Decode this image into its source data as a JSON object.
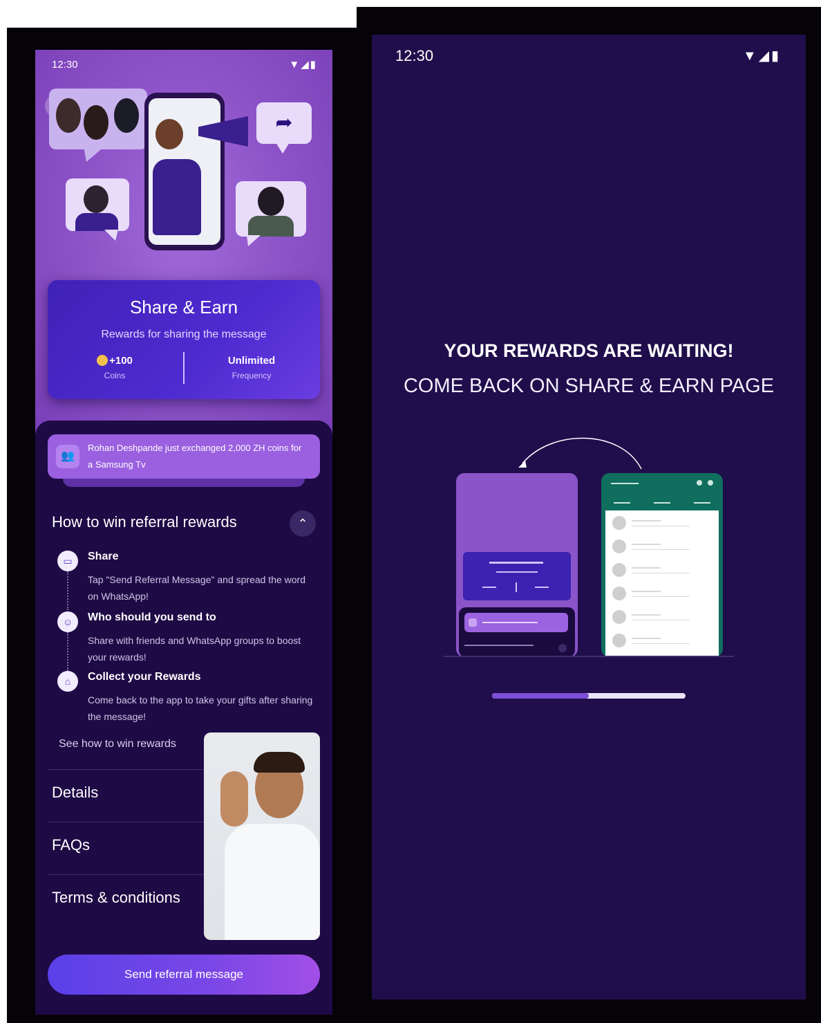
{
  "left_screen": {
    "status_time": "12:30",
    "status_icons": "▼◢▮",
    "card": {
      "title": "Share & Earn",
      "subtitle": "Rewards for sharing the message",
      "coins_value": "+100",
      "coins_label": "Coins",
      "frequency_value": "Unlimited",
      "frequency_label": "Frequency"
    },
    "ticker_text": "Rohan Deshpande just exchanged 2,000 ZH coins for a Samsung Tv",
    "howto_title": "How to win referral rewards",
    "steps": [
      {
        "title": "Share",
        "desc": "Tap \"Send Referral Message\" and spread the word on WhatsApp!"
      },
      {
        "title": "Who should you send to",
        "desc": "Share with friends and WhatsApp groups to boost your rewards!"
      },
      {
        "title": "Collect your Rewards",
        "desc": "Come back to the app to take your gifts after sharing the message!"
      }
    ],
    "see_how": "See how to win rewards",
    "rows": [
      "Details",
      "FAQs",
      "Terms & conditions"
    ],
    "cta": "Send referral message"
  },
  "right_screen": {
    "status_time": "12:30",
    "status_icons": "▼◢▮",
    "headline": "YOUR REWARDS ARE WAITING!",
    "subheadline": "COME BACK ON SHARE & EARN PAGE",
    "progress_fraction": 0.5
  },
  "colors": {
    "accent": "#7b4fd6",
    "background_dark": "#1f0e4b",
    "hero_purple": "#8e55c9",
    "whatsapp_green": "#0f6e5e"
  }
}
